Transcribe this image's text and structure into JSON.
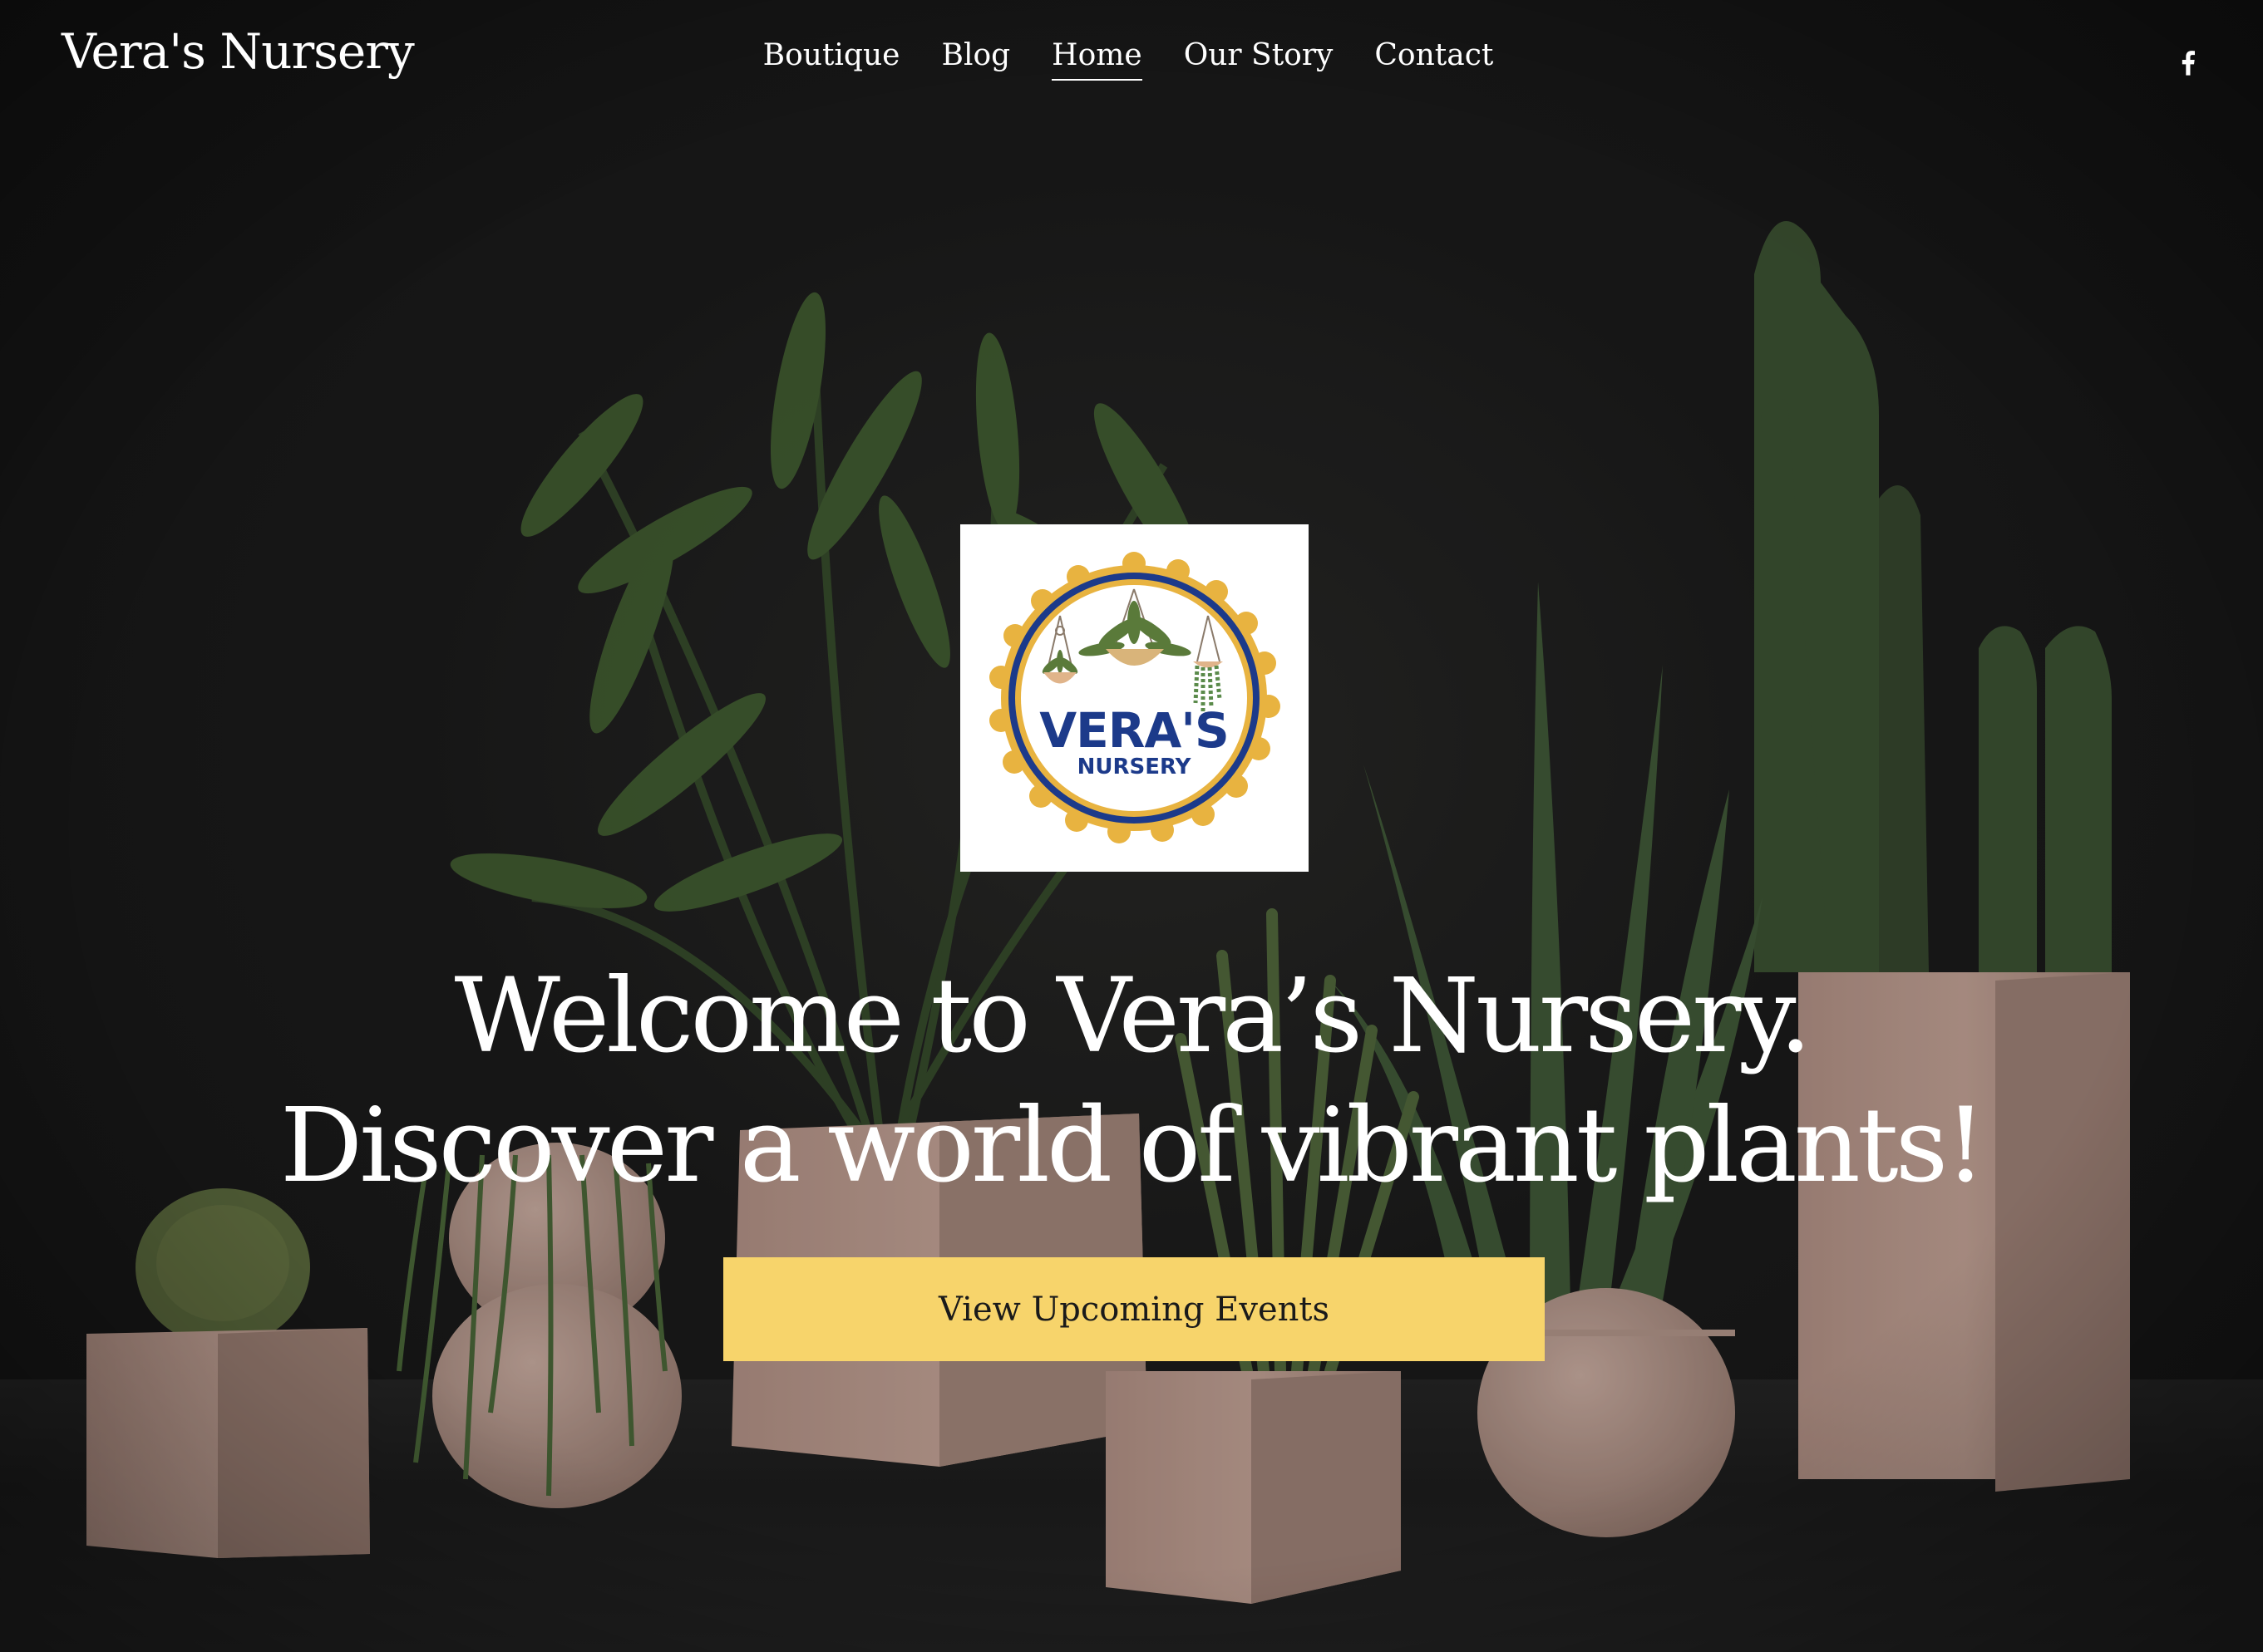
{
  "site": {
    "brand": "Vera's Nursery"
  },
  "nav": {
    "items": [
      {
        "label": "Boutique"
      },
      {
        "label": "Blog"
      },
      {
        "label": "Home",
        "active": true
      },
      {
        "label": "Our Story"
      },
      {
        "label": "Contact"
      }
    ],
    "social_icon": "facebook-icon"
  },
  "hero": {
    "logo": {
      "line1": "VERA'S",
      "line2": "NURSERY"
    },
    "headline_line1": "Welcome to Vera’s Nursery.",
    "headline_line2": "Discover a world of vibrant plants!",
    "cta_label": "View Upcoming Events"
  },
  "colors": {
    "background": "#1a1a1a",
    "cta": "#f7d46b",
    "logo_ring": "#e8b340",
    "logo_text": "#1c3a8a",
    "pot": "#c9a99a",
    "plant": "#3f5a33"
  }
}
